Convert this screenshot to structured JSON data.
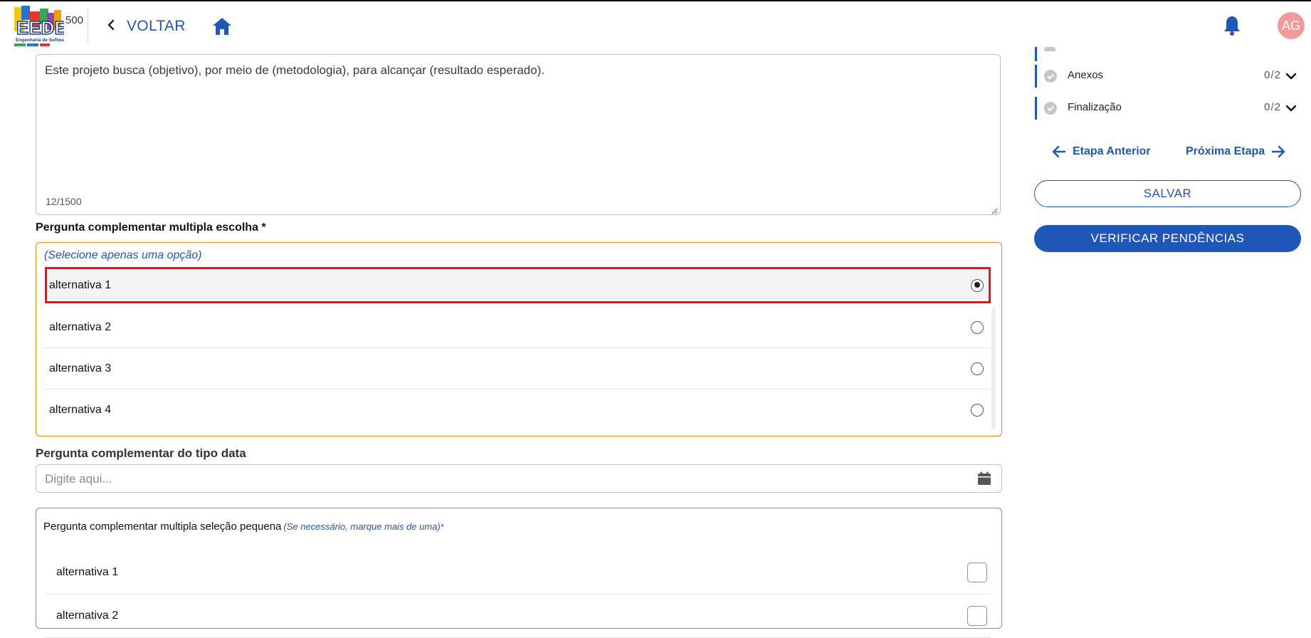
{
  "header": {
    "logo_alt": "EEDES Engenharia de Software",
    "logo_char_count": "500",
    "back_label": "VOLTAR",
    "home_icon": "home-icon",
    "bell_icon": "bell-icon",
    "avatar_initials": "AG"
  },
  "main": {
    "description_field": {
      "value": "Este projeto busca (objetivo), por meio de (metodologia), para alcançar (resultado esperado).",
      "char_count": "12/1500"
    },
    "multiple_choice": {
      "title": "Pergunta complementar multipla escolha *",
      "hint": "(Selecione apenas uma opção)",
      "options": [
        {
          "label": "alternativa 1",
          "selected": true
        },
        {
          "label": "alternativa 2",
          "selected": false
        },
        {
          "label": "alternativa 3",
          "selected": false
        },
        {
          "label": "alternativa 4",
          "selected": false
        }
      ]
    },
    "date_question": {
      "title": "Pergunta complementar do tipo data",
      "placeholder": "Digite aqui..."
    },
    "multi_select": {
      "title": "Pergunta complementar multipla seleção pequena",
      "hint": "(Se necessário, marque mais de uma)",
      "required_mark": "*",
      "options": [
        {
          "label": "alternativa 1",
          "checked": false
        },
        {
          "label": "alternativa 2",
          "checked": false
        }
      ]
    }
  },
  "sidebar": {
    "steps": [
      {
        "label": "Anexos",
        "count": "0/2"
      },
      {
        "label": "Finalização",
        "count": "0/2"
      }
    ],
    "prev_label": "Etapa Anterior",
    "next_label": "Próxima Etapa",
    "save_label": "SALVAR",
    "verify_label": "VERIFICAR PENDÊNCIAS"
  },
  "colors": {
    "primary": "#1f56b8",
    "selection_border": "#e8101c",
    "group_border": "#d88a1c",
    "avatar_bg": "#f29a99"
  }
}
